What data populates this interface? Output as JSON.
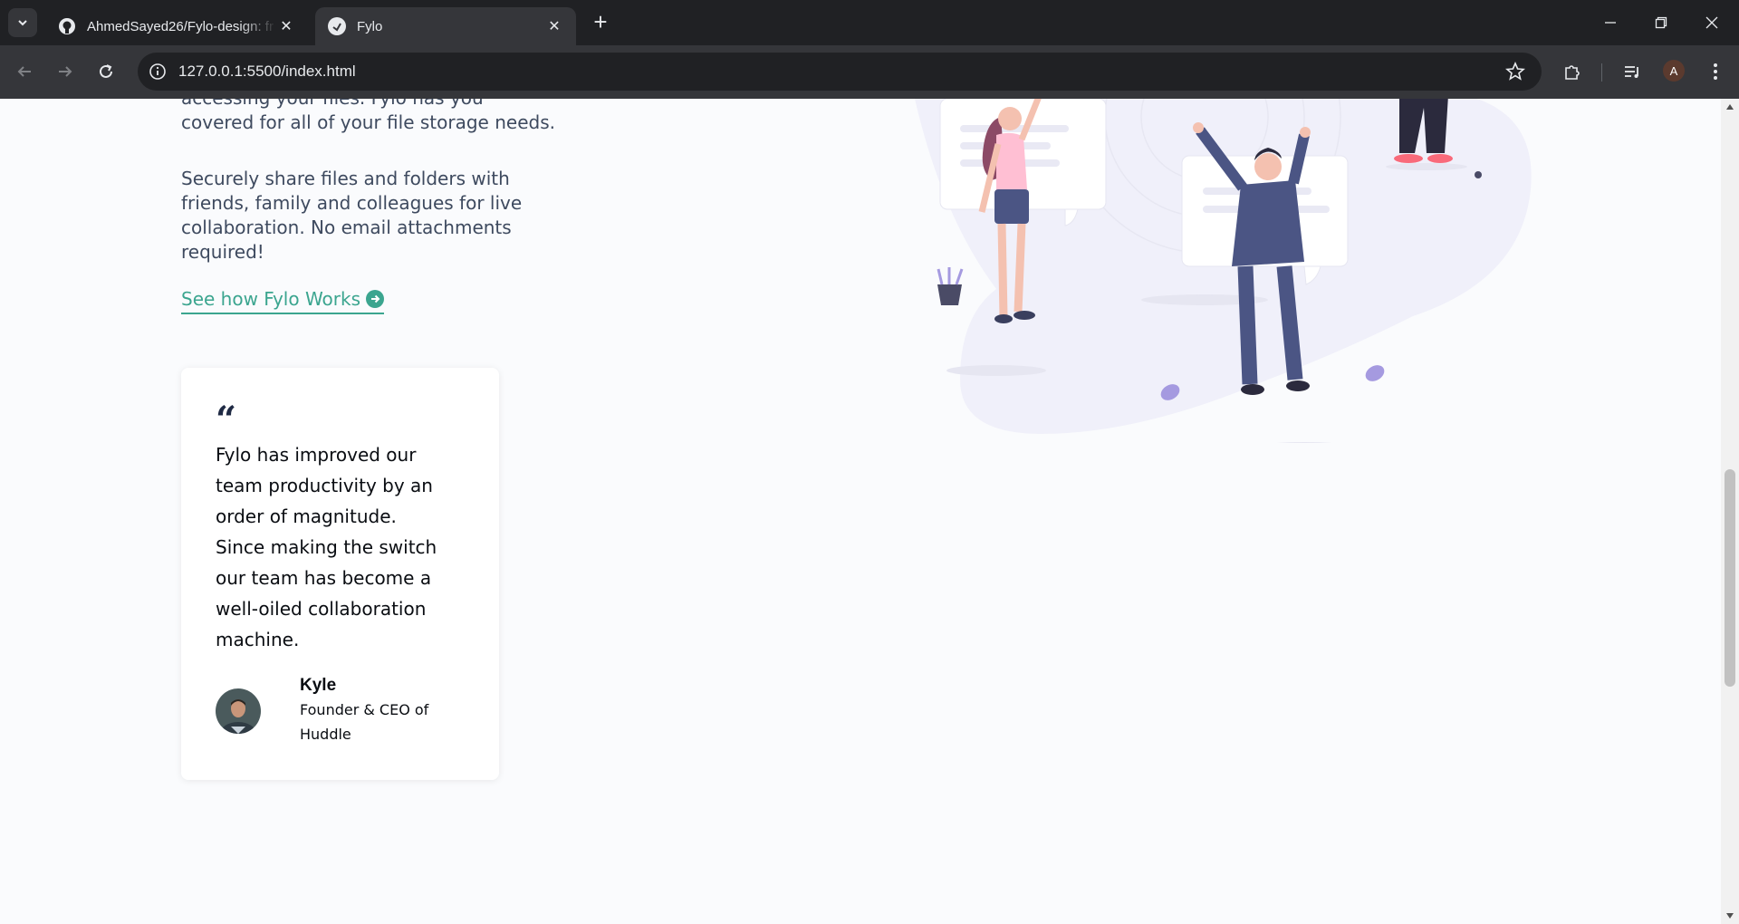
{
  "browser": {
    "tabs": [
      {
        "title": "AhmedSayed26/Fylo-design: fr",
        "icon": "github-icon",
        "active": false
      },
      {
        "title": "Fylo",
        "icon": "fylo-favicon",
        "active": true
      }
    ],
    "url": "127.0.0.1:5500/index.html",
    "profile_initial": "A"
  },
  "content": {
    "paragraph_1": "accessing your files. Fylo has you covered for all of your file storage needs.",
    "paragraph_2": "Securely share files and folders with friends, family and colleagues for live collaboration. No email attachments required!",
    "cta_label": "See how Fylo Works"
  },
  "testimonial": {
    "quote_mark": "“",
    "quote": "Fylo has improved our team productivity by an order of magnitude. Since making the switch our team has become a well-oiled collaboration machine.",
    "name": "Kyle",
    "role": "Founder & CEO of Huddle"
  },
  "colors": {
    "accent": "#3ba58f",
    "text": "#3e4a5f",
    "chrome_dark": "#202124",
    "chrome_toolbar": "#35363a"
  }
}
